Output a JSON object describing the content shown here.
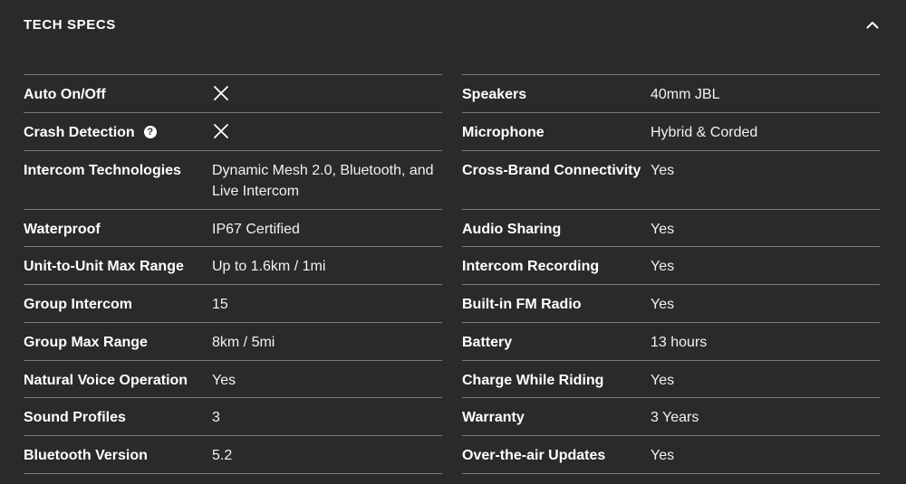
{
  "header": {
    "title": "TECH SPECS",
    "toggle_icon": "chevron-up-icon"
  },
  "colors": {
    "background": "#2a2a2a",
    "text": "#ffffff",
    "divider": "#7a7a7a"
  },
  "left_specs": [
    {
      "label": "Auto On/Off",
      "value": "",
      "value_icon": "x-icon"
    },
    {
      "label": "Crash Detection",
      "value": "",
      "value_icon": "x-icon",
      "label_icon": "help-icon"
    },
    {
      "label": "Intercom Technologies",
      "value": "Dynamic Mesh 2.0, Bluetooth, and Live Intercom"
    },
    {
      "label": "Waterproof",
      "value": "IP67 Certified"
    },
    {
      "label": "Unit-to-Unit Max Range",
      "value": "Up to 1.6km / 1mi"
    },
    {
      "label": "Group Intercom",
      "value": "15"
    },
    {
      "label": "Group Max Range",
      "value": "8km / 5mi"
    },
    {
      "label": "Natural Voice Operation",
      "value": "Yes"
    },
    {
      "label": "Sound Profiles",
      "value": "3"
    },
    {
      "label": "Bluetooth Version",
      "value": "5.2"
    }
  ],
  "right_specs": [
    {
      "label": "Speakers",
      "value": "40mm JBL"
    },
    {
      "label": "Microphone",
      "value": "Hybrid & Corded"
    },
    {
      "label": "Cross-Brand Connectivity",
      "value": "Yes"
    },
    {
      "label": "Audio Sharing",
      "value": "Yes"
    },
    {
      "label": "Intercom Recording",
      "value": "Yes"
    },
    {
      "label": "Built-in FM Radio",
      "value": "Yes"
    },
    {
      "label": "Battery",
      "value": "13 hours"
    },
    {
      "label": "Charge While Riding",
      "value": "Yes"
    },
    {
      "label": "Warranty",
      "value": "3 Years"
    },
    {
      "label": "Over-the-air Updates",
      "value": "Yes"
    }
  ]
}
